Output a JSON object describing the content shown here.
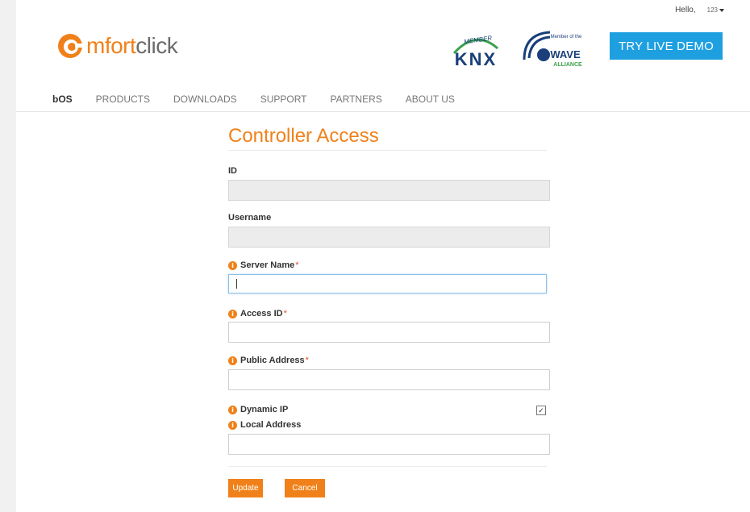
{
  "user": {
    "greeting": "Hello,",
    "account": "123"
  },
  "logo": {
    "brand_orange": "mfort",
    "brand_grey": "click"
  },
  "partners": {
    "knx_member": "MEMBER",
    "knx": "KNX",
    "zwave_member": "Member of the",
    "zwave": "WAVE",
    "zwave_alliance": "ALLIANCE"
  },
  "header": {
    "demo_label": "TRY LIVE DEMO"
  },
  "nav": {
    "items": [
      "bOS",
      "PRODUCTS",
      "DOWNLOADS",
      "SUPPORT",
      "PARTNERS",
      "ABOUT US"
    ]
  },
  "form": {
    "title": "Controller Access",
    "fields": {
      "id": {
        "label": "ID",
        "value": ""
      },
      "username": {
        "label": "Username",
        "value": ""
      },
      "server_name": {
        "label": "Server Name",
        "required": "*",
        "value": ""
      },
      "access_id": {
        "label": "Access ID",
        "required": "*",
        "value": ""
      },
      "public_address": {
        "label": "Public Address",
        "required": "*",
        "value": ""
      },
      "dynamic_ip": {
        "label": "Dynamic IP",
        "checked": true
      },
      "local_address": {
        "label": "Local Address",
        "value": ""
      }
    },
    "info_glyph": "i",
    "update_label": "Update",
    "cancel_label": "Cancel"
  },
  "colors": {
    "accent": "#f0811a",
    "demo": "#1ea0e0"
  }
}
